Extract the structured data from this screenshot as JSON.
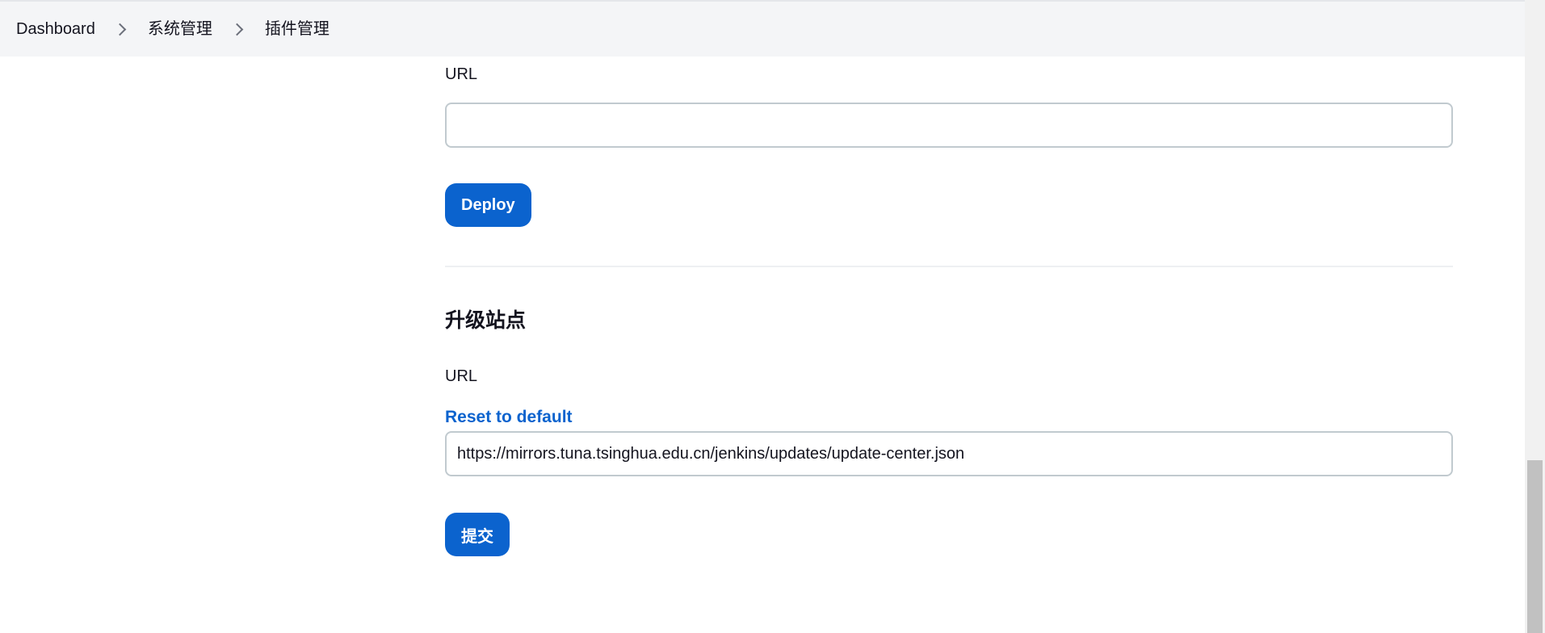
{
  "breadcrumb": {
    "items": [
      {
        "label": "Dashboard"
      },
      {
        "label": "系统管理"
      },
      {
        "label": "插件管理"
      }
    ]
  },
  "deploy_section": {
    "url_label": "URL",
    "url_value": "",
    "deploy_button": "Deploy"
  },
  "update_site_section": {
    "title": "升级站点",
    "url_label": "URL",
    "reset_link": "Reset to default",
    "url_value": "https://mirrors.tuna.tsinghua.edu.cn/jenkins/updates/update-center.json",
    "submit_button": "提交"
  },
  "colors": {
    "accent": "#0b63ce",
    "header_bg": "#f4f5f7",
    "input_border": "#c1cacf"
  }
}
